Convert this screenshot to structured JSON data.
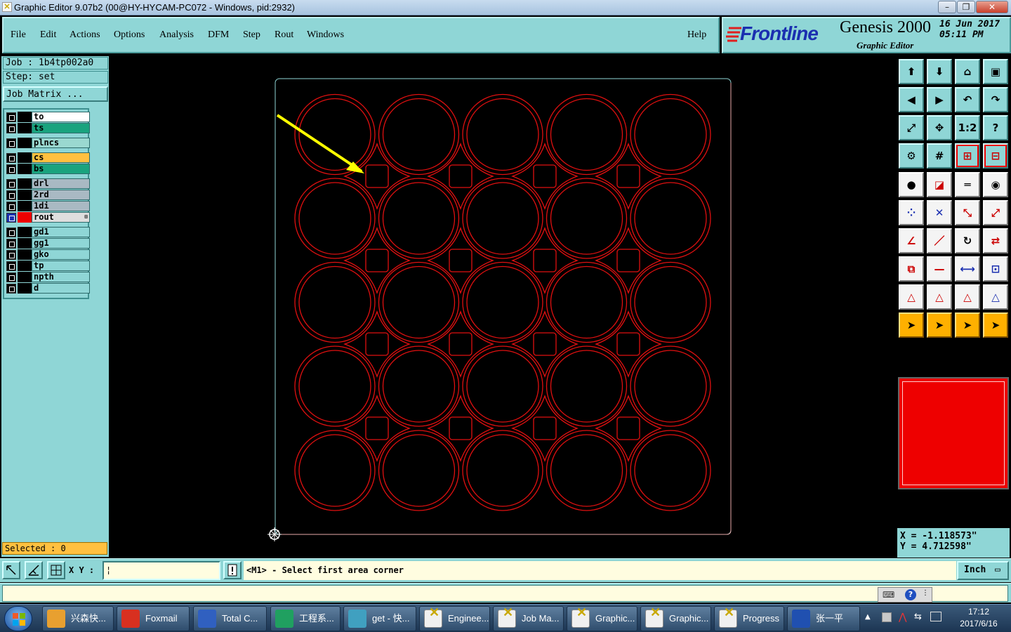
{
  "window": {
    "title": "Graphic Editor 9.07b2 (00@HY-HYCAM-PC072 - Windows, pid:2932)"
  },
  "menu": [
    {
      "label": "File"
    },
    {
      "label": "Edit"
    },
    {
      "label": "Actions"
    },
    {
      "label": "Options"
    },
    {
      "label": "Analysis"
    },
    {
      "label": "DFM"
    },
    {
      "label": "Step"
    },
    {
      "label": "Rout"
    },
    {
      "label": "Windows"
    }
  ],
  "help": "Help",
  "brand": {
    "logo": "Frontline",
    "product": "Genesis 2000",
    "subtitle": "Graphic Editor",
    "date": "16 Jun 2017",
    "time": "05:11 PM"
  },
  "job": {
    "job": "Job : 1b4tp002a0",
    "step": "Step: set",
    "matrix_button": "Job Matrix ..."
  },
  "layers": [
    {
      "name": "to",
      "color": "#ffffff"
    },
    {
      "name": "ts",
      "color": "#1aa37e"
    },
    {
      "name": "plncs",
      "color": "#9ad8d0"
    },
    {
      "name": "cs",
      "color": "#ffc040"
    },
    {
      "name": "bs",
      "color": "#1aa37e"
    },
    {
      "name": "drl",
      "color": "#a9b9c3"
    },
    {
      "name": "2rd",
      "color": "#a9b9c3"
    },
    {
      "name": "1di",
      "color": "#a9b9c3"
    },
    {
      "name": "rout",
      "color": "#dedede",
      "active": true
    },
    {
      "name": "gd1",
      "color": "#8fd6d6"
    },
    {
      "name": "gg1",
      "color": "#8fd6d6"
    },
    {
      "name": "gko",
      "color": "#8fd6d6"
    },
    {
      "name": "tp",
      "color": "#8fd6d6"
    },
    {
      "name": "npth",
      "color": "#8fd6d6"
    },
    {
      "name": "d",
      "color": "#8fd6d6"
    }
  ],
  "selected": "Selected : 0",
  "coords": {
    "x": "X = -1.118573\"",
    "y": "Y = 4.712598\""
  },
  "bottom": {
    "xy_label": "X Y :",
    "prompt": "<M1> - Select first area corner",
    "unit": "Inch"
  },
  "taskbar": {
    "items": [
      {
        "label": "兴森快...",
        "color": "#e8a030"
      },
      {
        "label": "Foxmail",
        "color": "#d83020"
      },
      {
        "label": "Total C...",
        "color": "#3060c0"
      },
      {
        "label": "工程系...",
        "color": "#20a060"
      },
      {
        "label": "get - 快...",
        "color": "#40a0c0"
      },
      {
        "label": "Enginee...",
        "color": "#f0f0f0"
      },
      {
        "label": "Job Ma...",
        "color": "#f0f0f0"
      },
      {
        "label": "Graphic...",
        "color": "#f0f0f0"
      },
      {
        "label": "Graphic...",
        "color": "#f0f0f0"
      },
      {
        "label": "Progress",
        "color": "#f0f0f0"
      },
      {
        "label": "张一平",
        "color": "#2050b0"
      }
    ],
    "time": "17:12",
    "date": "2017/6/16"
  }
}
